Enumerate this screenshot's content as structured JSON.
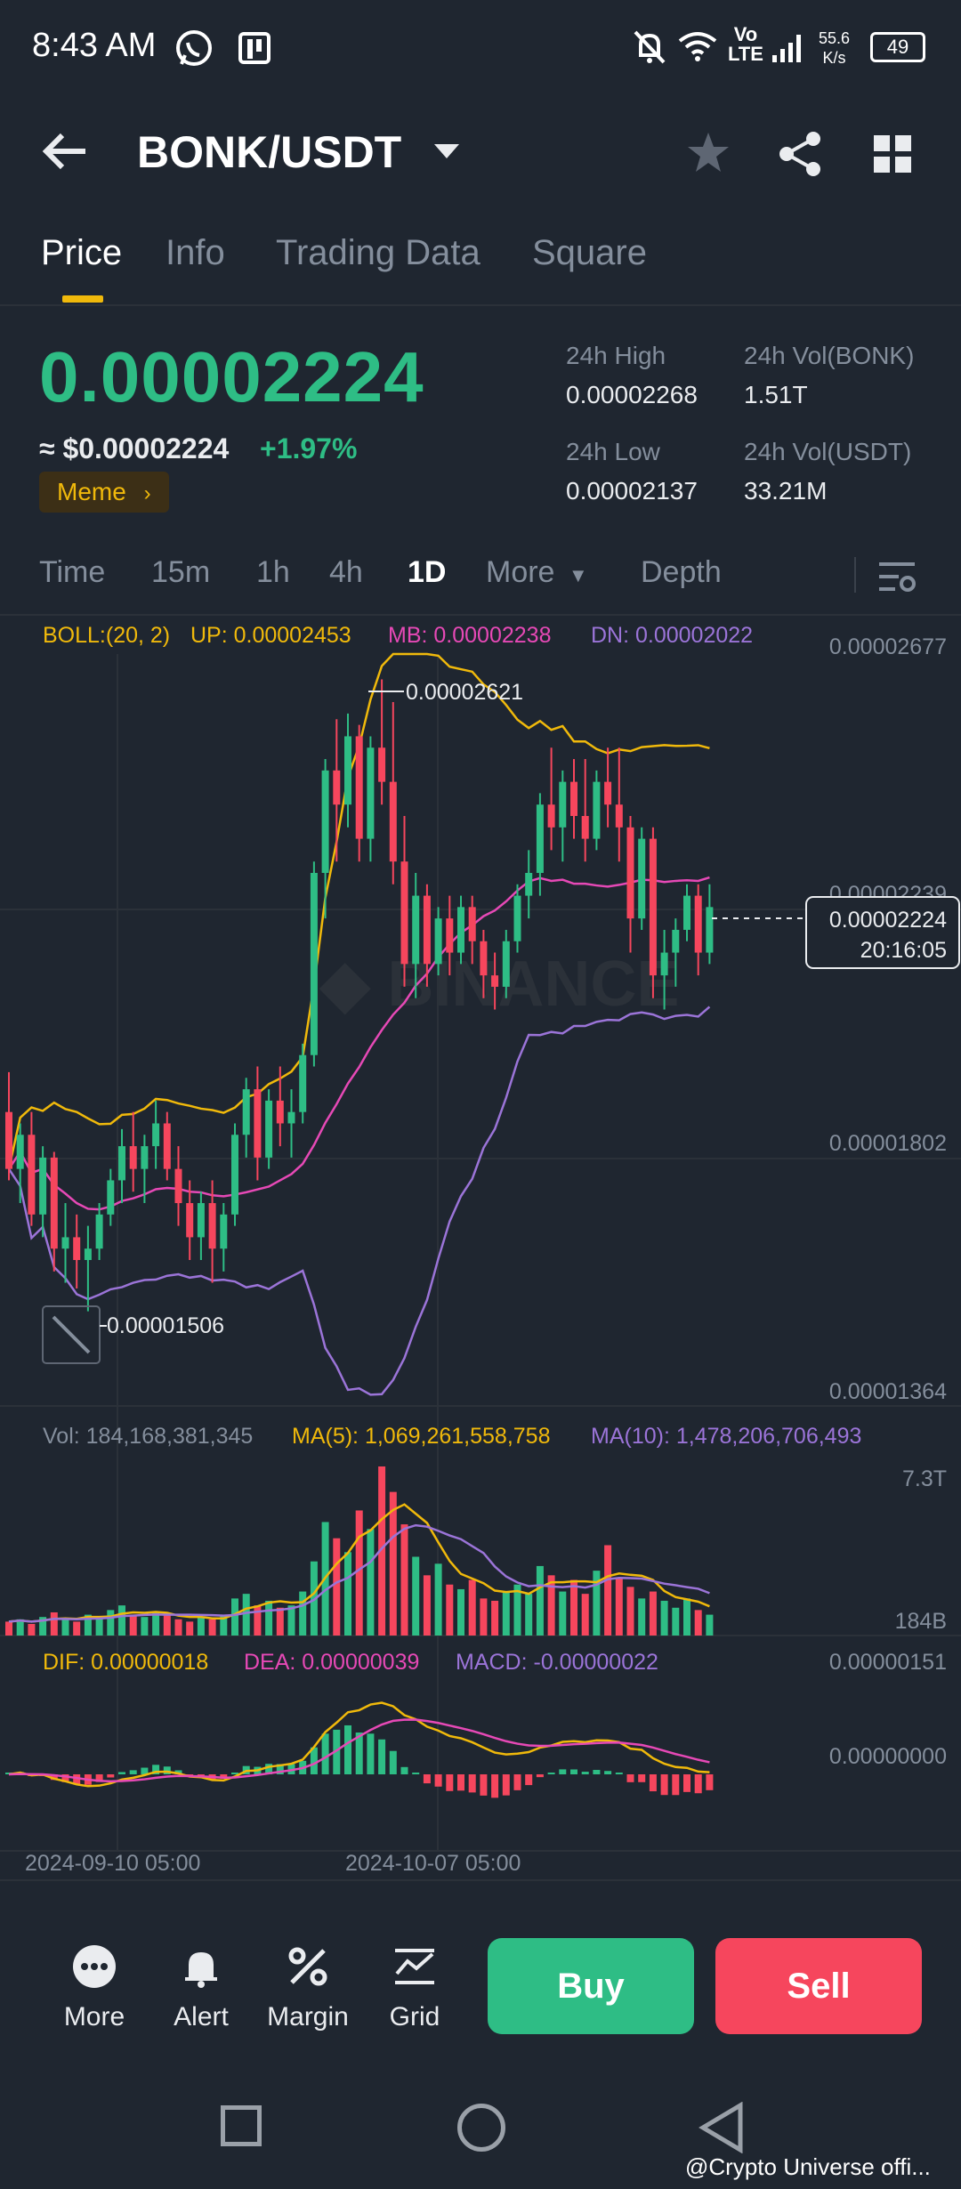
{
  "status_bar": {
    "time": "8:43 AM",
    "network_speed_value": "55.6",
    "network_speed_unit": "K/s",
    "battery": "49",
    "lte_label_1": "Vo",
    "lte_label_2": "LTE"
  },
  "header": {
    "pair": "BONK/USDT"
  },
  "tabs": [
    {
      "label": "Price",
      "active": true
    },
    {
      "label": "Info",
      "active": false
    },
    {
      "label": "Trading Data",
      "active": false
    },
    {
      "label": "Square",
      "active": false
    }
  ],
  "ticker": {
    "last_price": "0.00002224",
    "usd_price": "≈ $0.00002224",
    "change": "+1.97%",
    "tag": "Meme",
    "high_label": "24h High",
    "high_value": "0.00002268",
    "low_label": "24h Low",
    "low_value": "0.00002137",
    "vol_base_label": "24h Vol(BONK)",
    "vol_base_value": "1.51T",
    "vol_quote_label": "24h Vol(USDT)",
    "vol_quote_value": "33.21M"
  },
  "intervals": [
    {
      "label": "Time",
      "active": false
    },
    {
      "label": "15m",
      "active": false
    },
    {
      "label": "1h",
      "active": false
    },
    {
      "label": "4h",
      "active": false
    },
    {
      "label": "1D",
      "active": true
    },
    {
      "label": "More",
      "active": false
    },
    {
      "label": "Depth",
      "active": false
    }
  ],
  "indicators": {
    "boll_label": "BOLL:(20, 2)",
    "boll_up": "UP: 0.00002453",
    "boll_mb": "MB: 0.00002238",
    "boll_dn": "DN: 0.00002022",
    "vol": "Vol: 184,168,381,345",
    "vol_ma5": "MA(5): 1,069,261,558,758",
    "vol_ma10": "MA(10): 1,478,206,706,493",
    "dif": "DIF: 0.00000018",
    "dea": "DEA: 0.00000039",
    "macd": "MACD: -0.00000022"
  },
  "chart_data": {
    "type": "candlestick",
    "price_axis_ticks": [
      "0.00002677",
      "0.00002239",
      "0.00001802",
      "0.00001364"
    ],
    "price_range": [
      1.364e-05,
      2.677e-05
    ],
    "high_annotation": "0.00002621",
    "low_annotation": "0.00001506",
    "current_price_label": "0.00002224",
    "countdown": "20:16:05",
    "volume_axis_ticks": [
      "7.3T",
      "184B"
    ],
    "macd_axis_ticks": [
      "0.00000151",
      "0.00000000"
    ],
    "x_ticks": [
      "2024-09-10 05:00",
      "2024-10-07 05:00"
    ],
    "candles": [
      {
        "o": 1.86,
        "h": 1.93,
        "l": 1.74,
        "c": 1.76
      },
      {
        "o": 1.76,
        "h": 1.84,
        "l": 1.7,
        "c": 1.82
      },
      {
        "o": 1.82,
        "h": 1.86,
        "l": 1.66,
        "c": 1.68
      },
      {
        "o": 1.68,
        "h": 1.8,
        "l": 1.64,
        "c": 1.78
      },
      {
        "o": 1.78,
        "h": 1.79,
        "l": 1.58,
        "c": 1.62
      },
      {
        "o": 1.62,
        "h": 1.7,
        "l": 1.56,
        "c": 1.64
      },
      {
        "o": 1.64,
        "h": 1.68,
        "l": 1.55,
        "c": 1.6
      },
      {
        "o": 1.6,
        "h": 1.66,
        "l": 1.51,
        "c": 1.62
      },
      {
        "o": 1.62,
        "h": 1.7,
        "l": 1.6,
        "c": 1.68
      },
      {
        "o": 1.68,
        "h": 1.76,
        "l": 1.66,
        "c": 1.74
      },
      {
        "o": 1.74,
        "h": 1.83,
        "l": 1.7,
        "c": 1.8
      },
      {
        "o": 1.8,
        "h": 1.86,
        "l": 1.72,
        "c": 1.76
      },
      {
        "o": 1.76,
        "h": 1.82,
        "l": 1.7,
        "c": 1.8
      },
      {
        "o": 1.8,
        "h": 1.88,
        "l": 1.76,
        "c": 1.84
      },
      {
        "o": 1.84,
        "h": 1.86,
        "l": 1.74,
        "c": 1.76
      },
      {
        "o": 1.76,
        "h": 1.8,
        "l": 1.66,
        "c": 1.7
      },
      {
        "o": 1.7,
        "h": 1.74,
        "l": 1.6,
        "c": 1.64
      },
      {
        "o": 1.64,
        "h": 1.72,
        "l": 1.6,
        "c": 1.7
      },
      {
        "o": 1.7,
        "h": 1.74,
        "l": 1.56,
        "c": 1.62
      },
      {
        "o": 1.62,
        "h": 1.7,
        "l": 1.58,
        "c": 1.68
      },
      {
        "o": 1.68,
        "h": 1.84,
        "l": 1.66,
        "c": 1.82
      },
      {
        "o": 1.82,
        "h": 1.92,
        "l": 1.78,
        "c": 1.9
      },
      {
        "o": 1.9,
        "h": 1.94,
        "l": 1.74,
        "c": 1.78
      },
      {
        "o": 1.78,
        "h": 1.9,
        "l": 1.76,
        "c": 1.88
      },
      {
        "o": 1.88,
        "h": 1.94,
        "l": 1.8,
        "c": 1.84
      },
      {
        "o": 1.84,
        "h": 1.9,
        "l": 1.78,
        "c": 1.86
      },
      {
        "o": 1.86,
        "h": 1.98,
        "l": 1.84,
        "c": 1.96
      },
      {
        "o": 1.96,
        "h": 2.3,
        "l": 1.94,
        "c": 2.28
      },
      {
        "o": 2.28,
        "h": 2.48,
        "l": 2.2,
        "c": 2.46
      },
      {
        "o": 2.46,
        "h": 2.55,
        "l": 2.3,
        "c": 2.4
      },
      {
        "o": 2.4,
        "h": 2.56,
        "l": 2.36,
        "c": 2.52
      },
      {
        "o": 2.52,
        "h": 2.54,
        "l": 2.3,
        "c": 2.34
      },
      {
        "o": 2.34,
        "h": 2.52,
        "l": 2.3,
        "c": 2.5
      },
      {
        "o": 2.5,
        "h": 2.62,
        "l": 2.4,
        "c": 2.44
      },
      {
        "o": 2.44,
        "h": 2.58,
        "l": 2.26,
        "c": 2.3
      },
      {
        "o": 2.3,
        "h": 2.38,
        "l": 2.08,
        "c": 2.12
      },
      {
        "o": 2.12,
        "h": 2.28,
        "l": 2.06,
        "c": 2.24
      },
      {
        "o": 2.24,
        "h": 2.26,
        "l": 2.08,
        "c": 2.12
      },
      {
        "o": 2.12,
        "h": 2.22,
        "l": 2.1,
        "c": 2.2
      },
      {
        "o": 2.2,
        "h": 2.24,
        "l": 2.1,
        "c": 2.14
      },
      {
        "o": 2.14,
        "h": 2.24,
        "l": 2.12,
        "c": 2.22
      },
      {
        "o": 2.22,
        "h": 2.24,
        "l": 2.12,
        "c": 2.16
      },
      {
        "o": 2.16,
        "h": 2.18,
        "l": 2.06,
        "c": 2.1
      },
      {
        "o": 2.1,
        "h": 2.14,
        "l": 2.04,
        "c": 2.08
      },
      {
        "o": 2.08,
        "h": 2.18,
        "l": 2.06,
        "c": 2.16
      },
      {
        "o": 2.16,
        "h": 2.26,
        "l": 2.14,
        "c": 2.24
      },
      {
        "o": 2.24,
        "h": 2.32,
        "l": 2.2,
        "c": 2.28
      },
      {
        "o": 2.28,
        "h": 2.42,
        "l": 2.24,
        "c": 2.4
      },
      {
        "o": 2.4,
        "h": 2.5,
        "l": 2.32,
        "c": 2.36
      },
      {
        "o": 2.36,
        "h": 2.46,
        "l": 2.3,
        "c": 2.44
      },
      {
        "o": 2.44,
        "h": 2.48,
        "l": 2.34,
        "c": 2.38
      },
      {
        "o": 2.38,
        "h": 2.48,
        "l": 2.3,
        "c": 2.34
      },
      {
        "o": 2.34,
        "h": 2.46,
        "l": 2.32,
        "c": 2.44
      },
      {
        "o": 2.44,
        "h": 2.5,
        "l": 2.36,
        "c": 2.4
      },
      {
        "o": 2.4,
        "h": 2.5,
        "l": 2.3,
        "c": 2.36
      },
      {
        "o": 2.36,
        "h": 2.38,
        "l": 2.14,
        "c": 2.2
      },
      {
        "o": 2.2,
        "h": 2.36,
        "l": 2.18,
        "c": 2.34
      },
      {
        "o": 2.34,
        "h": 2.36,
        "l": 2.06,
        "c": 2.1
      },
      {
        "o": 2.1,
        "h": 2.18,
        "l": 2.04,
        "c": 2.14
      },
      {
        "o": 2.14,
        "h": 2.2,
        "l": 2.08,
        "c": 2.18
      },
      {
        "o": 2.18,
        "h": 2.26,
        "l": 2.16,
        "c": 2.24
      },
      {
        "o": 2.24,
        "h": 2.26,
        "l": 2.1,
        "c": 2.14
      },
      {
        "o": 2.14,
        "h": 2.26,
        "l": 2.12,
        "c": 2.22
      }
    ],
    "volume_ma_note": "volumes normalized to 7.3T scale",
    "volumes": [
      0.6,
      0.7,
      0.5,
      0.8,
      1.0,
      0.7,
      0.6,
      0.9,
      0.8,
      1.1,
      1.3,
      0.9,
      0.8,
      1.0,
      0.9,
      0.7,
      0.6,
      0.8,
      0.7,
      0.9,
      1.6,
      1.8,
      1.3,
      1.5,
      1.2,
      1.3,
      1.9,
      3.2,
      4.9,
      4.2,
      3.6,
      5.4,
      4.6,
      7.3,
      6.2,
      4.8,
      3.4,
      2.6,
      3.1,
      2.2,
      2.0,
      2.4,
      1.6,
      1.5,
      1.9,
      2.2,
      1.8,
      3.0,
      2.6,
      1.9,
      2.4,
      1.8,
      2.8,
      3.9,
      2.5,
      2.1,
      1.6,
      1.9,
      1.5,
      1.2,
      1.6,
      1.1,
      0.9
    ]
  },
  "actions": {
    "more": "More",
    "alert": "Alert",
    "margin": "Margin",
    "grid": "Grid",
    "buy": "Buy",
    "sell": "Sell"
  },
  "colors": {
    "up": "#2ebd85",
    "down": "#f6465d",
    "accent": "#f0b90b",
    "boll_up": "#f0b90b",
    "boll_mb": "#e649b6",
    "boll_dn": "#9b74d8"
  },
  "watermark": "@Crypto Universe offi..."
}
